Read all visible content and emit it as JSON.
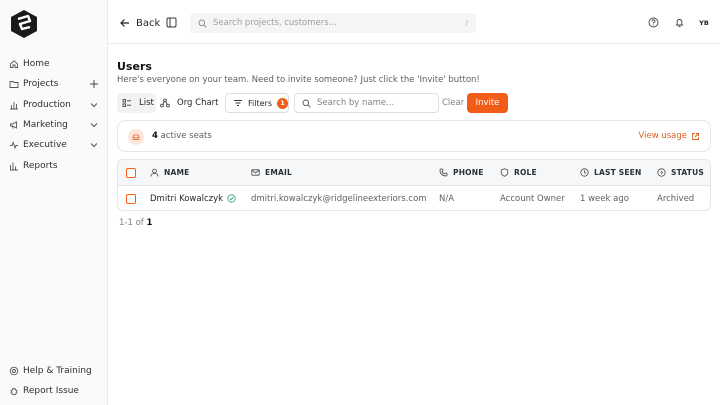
{
  "sidebar": {
    "items": [
      {
        "label": "Home",
        "icon": "home-icon"
      },
      {
        "label": "Projects",
        "icon": "folder-icon",
        "trail": "plus-icon"
      },
      {
        "label": "Production",
        "icon": "bar-chart-icon",
        "trail": "chevron-down-icon"
      },
      {
        "label": "Marketing",
        "icon": "megaphone-icon",
        "trail": "chevron-down-icon"
      },
      {
        "label": "Executive",
        "icon": "activity-icon",
        "trail": "chevron-down-icon"
      },
      {
        "label": "Reports",
        "icon": "chart-icon"
      }
    ],
    "bottom_items": [
      {
        "label": "Help & Training",
        "icon": "lifebuoy-icon"
      },
      {
        "label": "Report Issue",
        "icon": "bug-icon"
      }
    ]
  },
  "topbar": {
    "back_label": "Back",
    "search_placeholder": "Search projects, customers...",
    "search_shortcut": "/",
    "avatar_initials": "YB"
  },
  "page": {
    "title": "Users",
    "subtitle": "Here's everyone on your team. Need to invite someone? Just click the 'Invite' button!"
  },
  "toolbar": {
    "list_label": "List",
    "org_chart_label": "Org Chart",
    "filters_label": "Filters",
    "filters_count": "1",
    "search_placeholder": "Search by name...",
    "clear_label": "Clear",
    "invite_label": "Invite"
  },
  "seats": {
    "count": "4",
    "label": "active seats",
    "view_usage_label": "View usage"
  },
  "table": {
    "columns": [
      "NAME",
      "EMAIL",
      "PHONE",
      "ROLE",
      "LAST SEEN",
      "STATUS"
    ],
    "rows": [
      {
        "name": "Dmitri Kowalczyk",
        "email": "dmitri.kowalczyk@ridgelineexteriors.com",
        "phone": "N/A",
        "role": "Account Owner",
        "last_seen": "1 week ago",
        "status": "Archived"
      }
    ]
  },
  "pagination": {
    "range": "1-1",
    "of_label": "of",
    "total": "1"
  },
  "colors": {
    "accent": "#f25c19",
    "link": "#e0611f",
    "verified": "#2e9e6b"
  }
}
